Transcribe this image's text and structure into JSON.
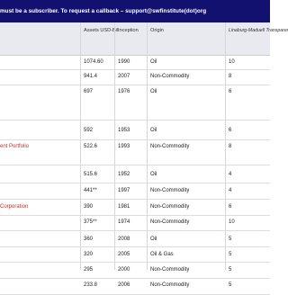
{
  "banner": {
    "text": "must be a subscriber. To request a callback – support@swfinstitute(dot)org"
  },
  "table": {
    "headers": {
      "assets": "Assets USD-Bil",
      "inception": "Inception",
      "origin": "Origin",
      "rating": "Linaburg-Maduell Transparency Ind"
    },
    "rows": [
      {
        "name": "",
        "assets": "1074.60",
        "inception": "1990",
        "origin": "Oil",
        "rating": "10"
      },
      {
        "name": "",
        "assets": "941.4",
        "inception": "2007",
        "origin": "Non-Commodity",
        "rating": "8"
      },
      {
        "name": "",
        "assets": "697",
        "inception": "1976",
        "origin": "Oil",
        "rating": "6"
      },
      {
        "name": "",
        "assets": "592",
        "inception": "1953",
        "origin": "Oil",
        "rating": "6"
      },
      {
        "name": "ent Portfolio",
        "assets": "522.6",
        "inception": "1993",
        "origin": "Non-Commodity",
        "rating": "8"
      },
      {
        "name": "",
        "assets": "515.6",
        "inception": "1952",
        "origin": "Oil",
        "rating": "4"
      },
      {
        "name": "",
        "assets": "441**",
        "inception": "1997",
        "origin": "Non-Commodity",
        "rating": "4"
      },
      {
        "name": "Corporation",
        "assets": "390",
        "inception": "1981",
        "origin": "Non-Commodity",
        "rating": "6"
      },
      {
        "name": "",
        "assets": "375**",
        "inception": "1974",
        "origin": "Non-Commodity",
        "rating": "10"
      },
      {
        "name": "",
        "assets": "360",
        "inception": "2008",
        "origin": "Oil",
        "rating": "5"
      },
      {
        "name": "",
        "assets": "320",
        "inception": "2005",
        "origin": "Oil & Gas",
        "rating": "5"
      },
      {
        "name": "",
        "assets": "295",
        "inception": "2000",
        "origin": "Non-Commodity",
        "rating": "5"
      },
      {
        "name": "",
        "assets": "233.8",
        "inception": "2006",
        "origin": "Non-Commodity",
        "rating": "5"
      }
    ]
  }
}
